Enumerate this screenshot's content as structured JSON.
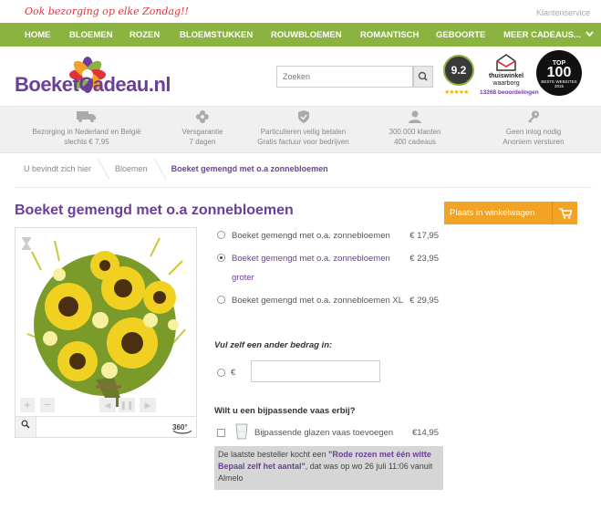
{
  "topbar": {
    "tagline": "Ook bezorging op elke Zondag!!",
    "service_link": "Klantenservice"
  },
  "nav": {
    "items": [
      "HOME",
      "BLOEMEN",
      "ROZEN",
      "BLOEMSTUKKEN",
      "ROUWBLOEMEN",
      "ROMANTISCH",
      "GEBOORTE",
      "MEER CADEAUS..."
    ]
  },
  "header": {
    "logo_name": "BoeketCadeau",
    "logo_tld": ".nl",
    "search_placeholder": "Zoeken",
    "rating_score": "9.2",
    "rating_stars": "★★★★★",
    "reviews_text": "13268 beoordelingen",
    "thuiswinkel_line1": "thuiswinkel",
    "thuiswinkel_line2": "waarborg",
    "top100_brand": "TOP",
    "top100_number": "100",
    "top100_caption": "BESTE WEBSITES 2015"
  },
  "usps": [
    {
      "icon": "truck-icon",
      "line1": "Bezorging in Nederland en België",
      "line2": "slechts € 7,95"
    },
    {
      "icon": "flower-icon",
      "line1": "Versgarantie",
      "line2": "7 dagen"
    },
    {
      "icon": "shield-icon",
      "line1": "Particulieren veilig betalen",
      "line2": "Gratis factuur voor bedrijven"
    },
    {
      "icon": "user-icon",
      "line1": "300.000 klanten",
      "line2": "400 cadeaus"
    },
    {
      "icon": "key-icon",
      "line1": "Geen inlog nodig",
      "line2": "Anoniem versturen"
    }
  ],
  "breadcrumb": {
    "home": "U bevindt zich hier",
    "category": "Bloemen",
    "current": "Boeket gemengd met o.a zonnebloemen"
  },
  "product": {
    "title": "Boeket gemengd met o.a zonnebloemen",
    "cart_label": "Plaats in winkelwagen",
    "options": [
      {
        "label": "Boeket gemengd met o.a. zonnebloemen",
        "price": "€ 17,95",
        "checked": false
      },
      {
        "label": "Boeket gemengd met o.a. zonnebloemen",
        "label2": "groter",
        "price": "€ 23,95",
        "checked": true
      },
      {
        "label": "Boeket gemengd met o.a. zonnebloemen XL",
        "price": "€ 29,95",
        "checked": false
      }
    ],
    "custom_amount_title": "Vul zelf een ander bedrag in:",
    "currency_symbol": "€",
    "vase_title": "Wilt u een bijpassende vaas erbij?",
    "vase_label": "Bijpassende glazen vaas toevoegen",
    "vase_price": "€14,95",
    "notice_prefix": "De laatste besteller kocht een ",
    "notice_product": "\"Rode rozen met één witte Bepaal zelf het aantal\"",
    "notice_suffix": ", dat was op wo 26 juli 11:06 vanuit Almelo"
  },
  "gallery": {
    "deg_label": "360°"
  },
  "colors": {
    "brand_purple": "#6b3f99",
    "nav_green": "#8bb340",
    "cart_orange": "#f2a225"
  }
}
